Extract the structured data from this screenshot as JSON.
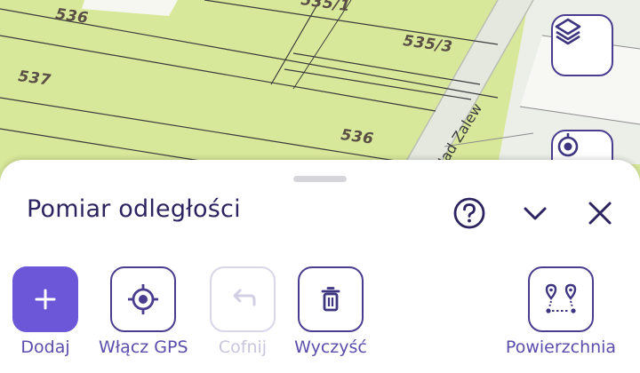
{
  "map": {
    "parcels": [
      "536",
      "535/1",
      "535/3",
      "537",
      "536"
    ],
    "street": "Nad Zalew",
    "layers_icon": "layers-icon",
    "locate_icon": "crosshair-icon"
  },
  "sheet": {
    "title": "Pomiar odległości",
    "help_icon": "question-circle-icon",
    "collapse_icon": "chevron-down-icon",
    "close_icon": "close-icon"
  },
  "tools": {
    "add": "Dodaj",
    "gps": "Włącz GPS",
    "undo": "Cofnij",
    "clear": "Wyczyść",
    "area": "Powierzchnia"
  },
  "colors": {
    "accent": "#6b57d8",
    "dark": "#2c2461",
    "map_fill": "#d8e89a",
    "disabled": "#c9c5de"
  }
}
